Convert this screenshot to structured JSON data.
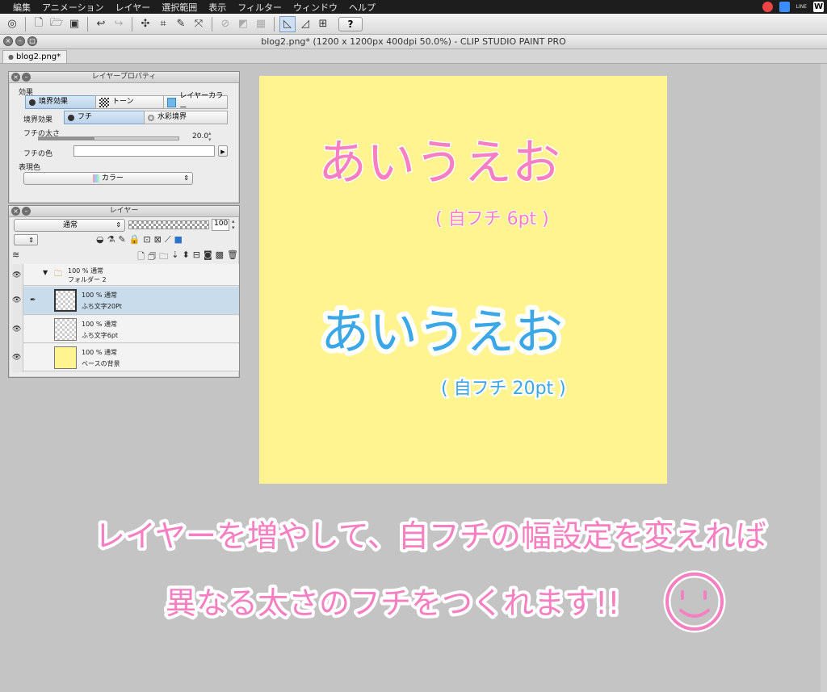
{
  "menu": [
    "編集",
    "アニメーション",
    "レイヤー",
    "選択範囲",
    "表示",
    "フィルター",
    "ウィンドウ",
    "ヘルプ"
  ],
  "menu_right_icons": [
    "creative-cloud-icon",
    "dropbox-icon",
    "line-icon",
    "word-icon"
  ],
  "menu_line_label": "LINE",
  "menu_word_label": "W",
  "toolbar": {
    "help_label": "?"
  },
  "window": {
    "title": "blog2.png* (1200 x 1200px 400dpi 50.0%)  - CLIP STUDIO PAINT PRO",
    "tab": "blog2.png*"
  },
  "layer_property": {
    "title": "レイヤープロパティ",
    "effect_label": "効果",
    "effects": [
      "境界効果",
      "トーン",
      "レイヤーカラー"
    ],
    "border_label": "境界効果",
    "border_options": [
      "フチ",
      "水彩境界"
    ],
    "thickness_label": "フチの太さ",
    "thickness_value": "20.0",
    "thickness_level": 0.4,
    "edge_color_label": "フチの色",
    "expression_label": "表現色",
    "expression_value": "カラー"
  },
  "layer_panel": {
    "title": "レイヤー",
    "blend_mode": "通常",
    "opacity": "100",
    "layers": [
      {
        "line1": "100 % 通常",
        "line2": "フォルダー 2"
      },
      {
        "line1": "100 % 通常",
        "line2": "ふち文字20Pt"
      },
      {
        "line1": "100 % 通常",
        "line2": "ふち文字6pt"
      },
      {
        "line1": "100 % 通常",
        "line2": "ベースの背景"
      }
    ]
  },
  "canvas": {
    "bg_color": "#fff48f",
    "text1": "あいうえお",
    "note1": "( 自フチ 6pt )",
    "text2": "あいうえお",
    "note2": "( 自フチ 20pt )"
  },
  "caption": {
    "line1": "レイヤーを増やして、自フチの幅設定を変えれば",
    "line2": "異なる太さのフチをつくれます!!",
    "pink": "#f57fc1"
  }
}
